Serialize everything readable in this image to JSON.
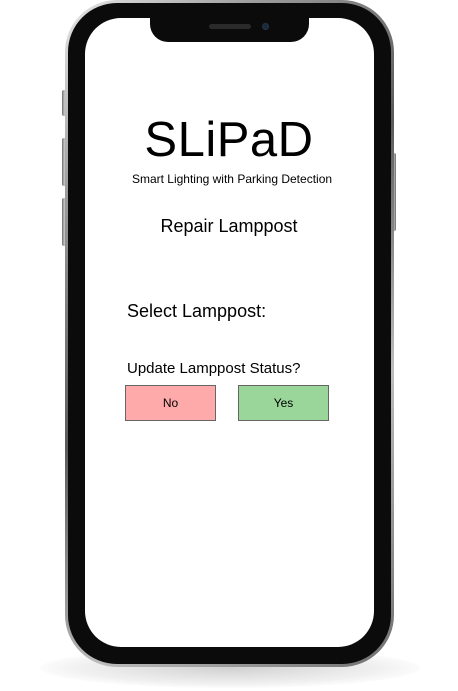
{
  "app": {
    "title": "SLiPaD",
    "subtitle": "Smart Lighting with Parking Detection"
  },
  "screen": {
    "page_title": "Repair Lamppost",
    "select_label": "Select Lamppost:",
    "status_question": "Update Lamppost Status?"
  },
  "buttons": {
    "no_label": "No",
    "yes_label": "Yes"
  },
  "colors": {
    "no_button": "#ffaaaa",
    "yes_button": "#9ad69a",
    "button_border": "#666666",
    "screen_background": "#ffffff",
    "phone_bezel": "#0b0b0b"
  }
}
